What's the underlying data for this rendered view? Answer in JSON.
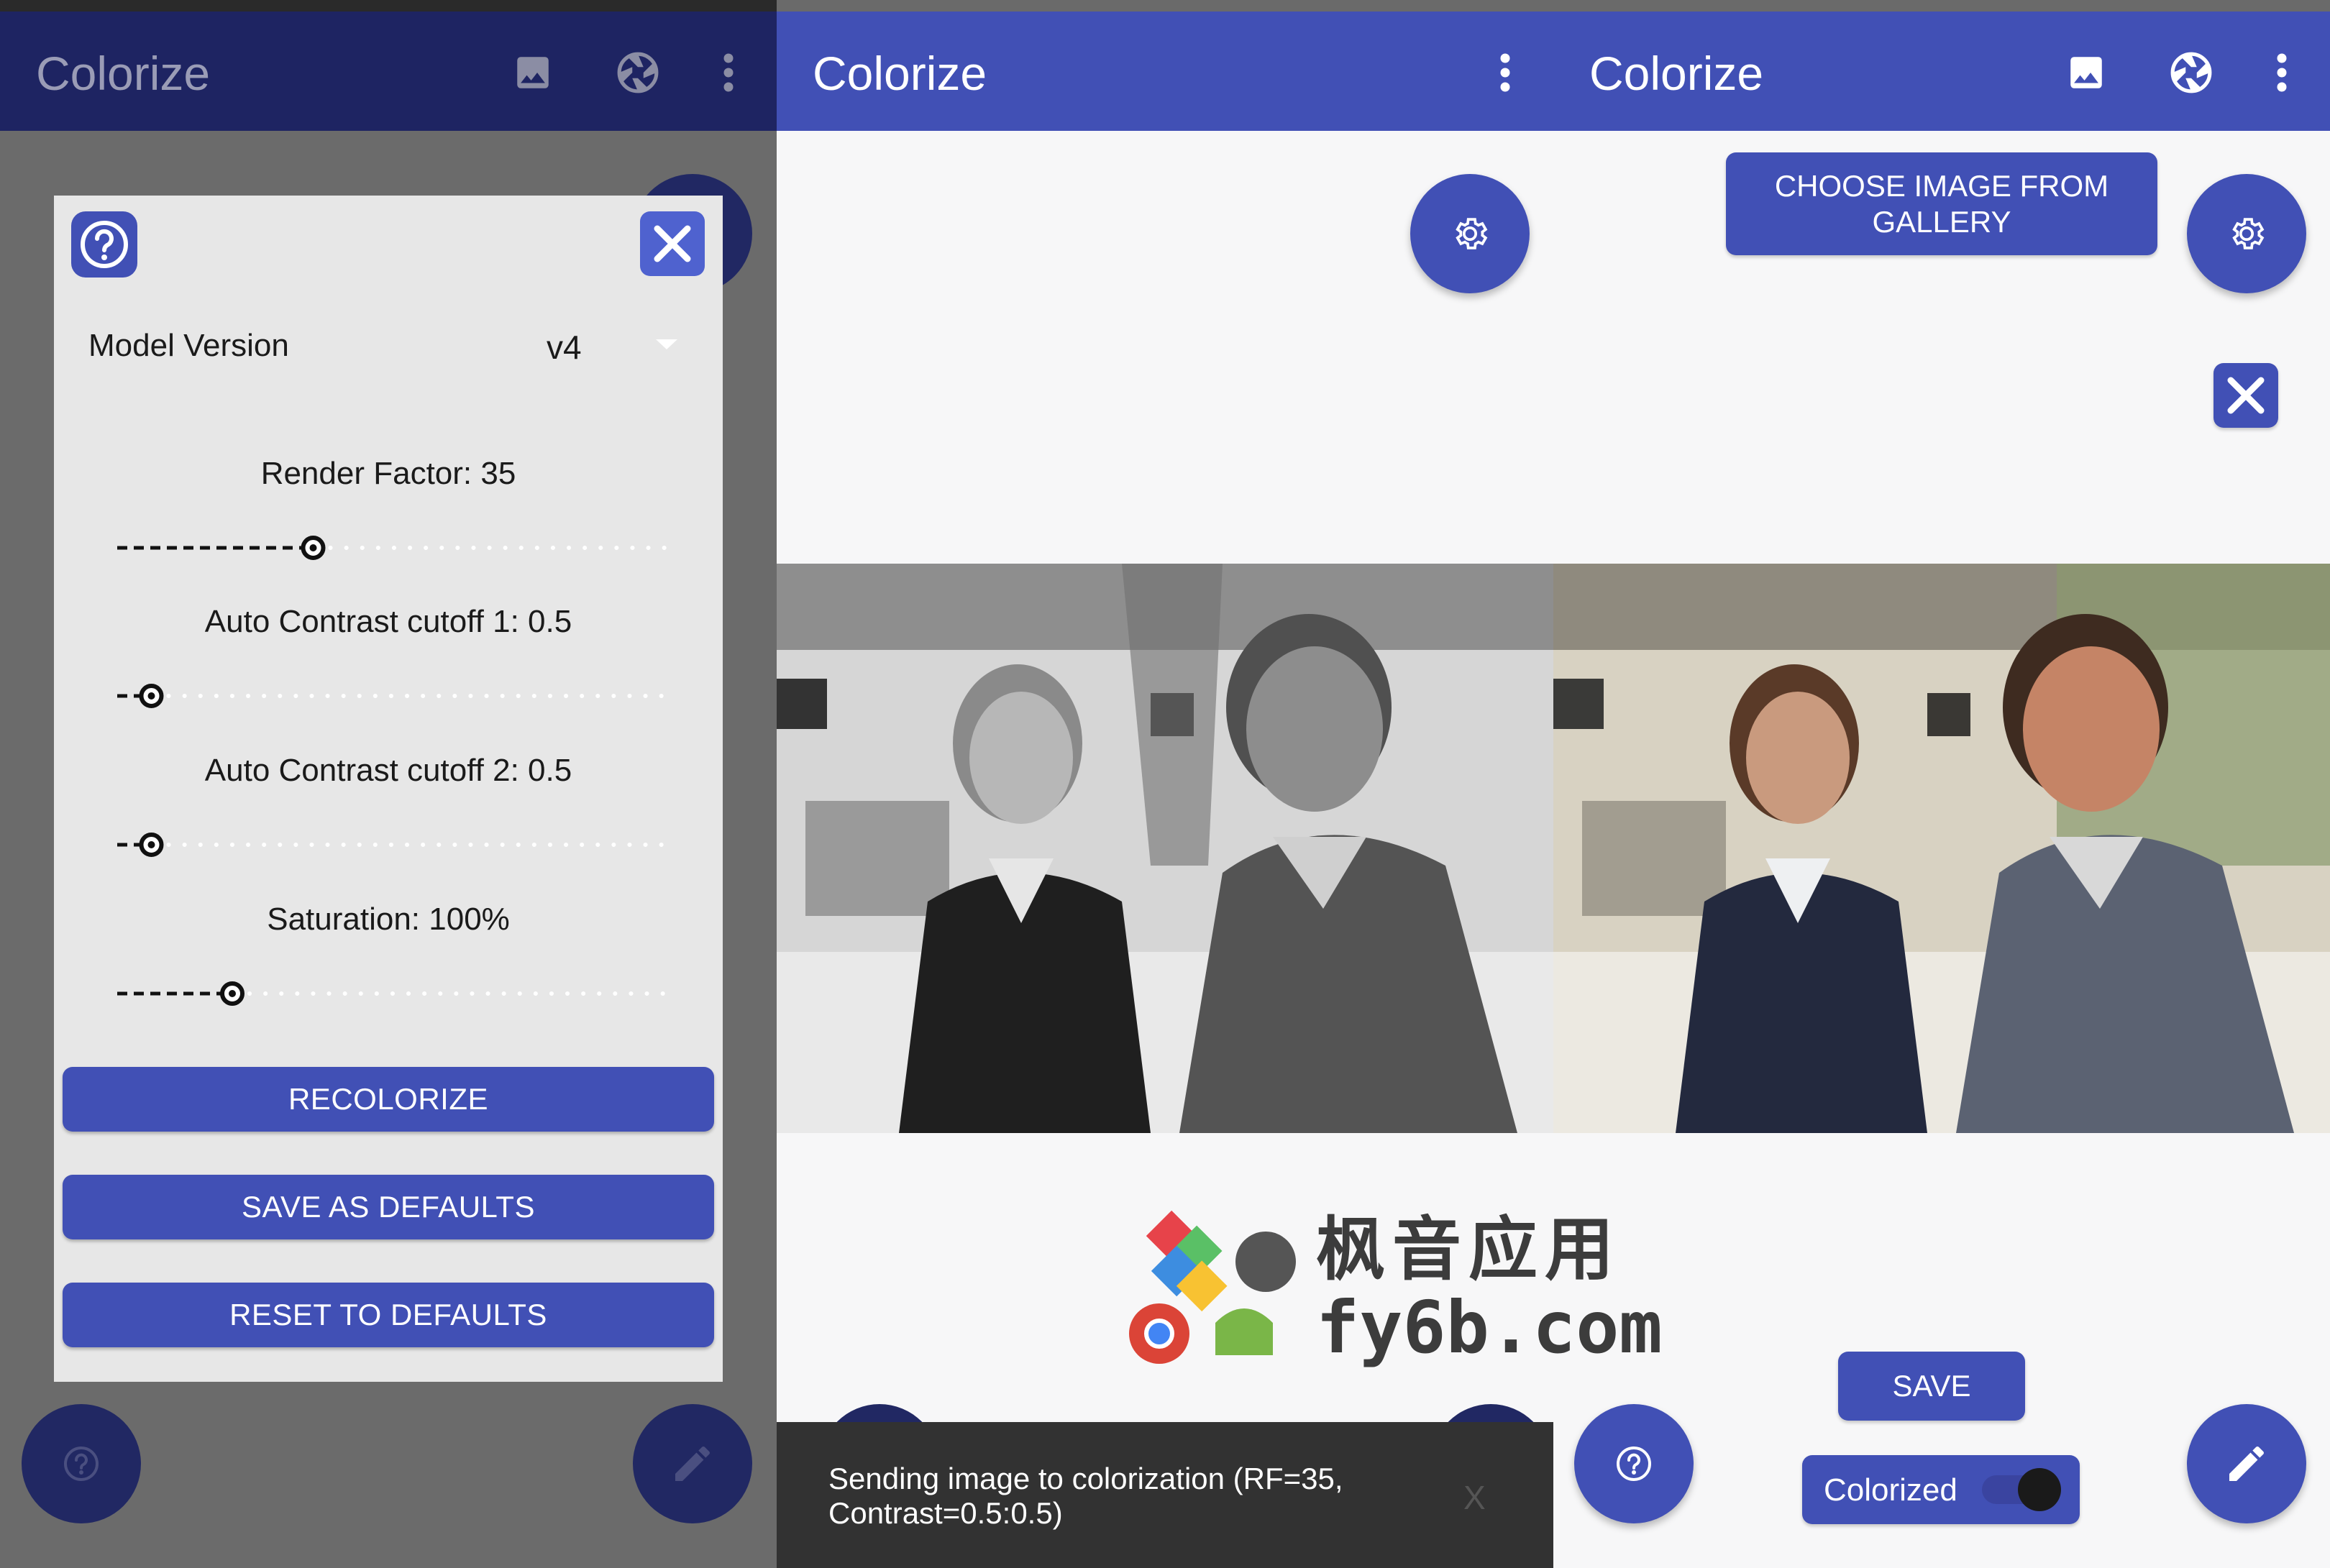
{
  "app": {
    "title": "Colorize"
  },
  "dialog": {
    "model_label": "Model Version",
    "model_value": "v4",
    "render_factor": {
      "label": "Render Factor: 35",
      "value": 35,
      "min": 0,
      "max": 100
    },
    "contrast1": {
      "label": "Auto Contrast cutoff 1: 0.5",
      "value": 0.5,
      "min": 0,
      "max": 10
    },
    "contrast2": {
      "label": "Auto Contrast cutoff 2: 0.5",
      "value": 0.5,
      "min": 0,
      "max": 10
    },
    "saturation": {
      "label": "Saturation: 100%",
      "value": 100,
      "min": 0,
      "max": 500
    },
    "recolorize": "RECOLORIZE",
    "save_defaults": "SAVE AS DEFAULTS",
    "reset_defaults": "RESET TO DEFAULTS"
  },
  "gallery_button": {
    "line1": "CHOOSE IMAGE FROM",
    "line2": "GALLERY"
  },
  "snackbar": {
    "line1": "Sending image to colorization (RF=35,",
    "line2": "Contrast=0.5:0.5)",
    "dismiss": "X"
  },
  "save_button": "SAVE",
  "toggle": {
    "label": "Colorized",
    "on": true
  },
  "watermark": {
    "chars": "枫音应用",
    "url": "fy6b.com"
  },
  "colors": {
    "primary": "#4150b5",
    "primary_dark": "#1e2462",
    "accent": "#6b6cf0"
  },
  "icons": [
    "image-icon",
    "aperture-icon",
    "more-vert-icon",
    "settings-icon",
    "help-icon",
    "close-icon",
    "pencil-icon"
  ]
}
